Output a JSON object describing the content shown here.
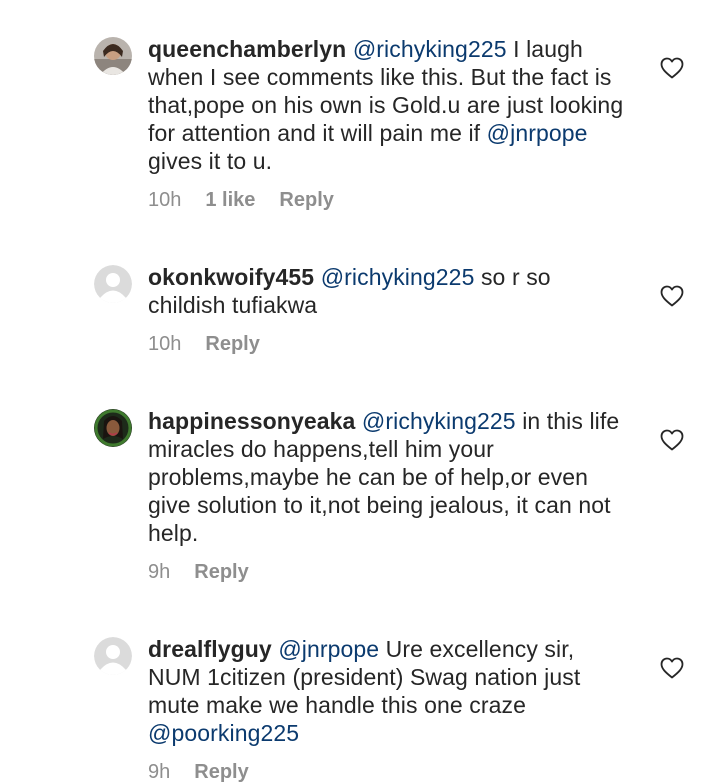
{
  "comments": [
    {
      "username": "queenchamberlyn",
      "mention": "@richyking225",
      "text_parts": [
        " I laugh when I see comments like this. But the fact is that,pope on his own is Gold.u are just looking for attention and it will pain me if ",
        "@jnrpope",
        " gives it to u."
      ],
      "time": "10h",
      "likes": "1 like",
      "reply": "Reply",
      "avatar": "photo"
    },
    {
      "username": "okonkwoify455",
      "mention": "@richyking225",
      "text_parts": [
        "  so r so childish tufiakwa"
      ],
      "time": "10h",
      "reply": "Reply",
      "avatar": "default"
    },
    {
      "username": "happinessonyeaka",
      "mention": "@richyking225",
      "text_parts": [
        " in this life miracles do happens,tell him your problems,maybe he can be of help,or even give solution to it,not being jealous, it can not help."
      ],
      "time": "9h",
      "reply": "Reply",
      "avatar": "photo-dark"
    },
    {
      "username": "drealflyguy",
      "mention": "@jnrpope",
      "text_parts": [
        " Ure excellency sir, NUM 1citizen (president) Swag nation just mute make  we handle this one craze ",
        "@poorking225"
      ],
      "time": "9h",
      "reply": "Reply",
      "avatar": "default"
    }
  ],
  "colors": {
    "text": "#262626",
    "mention": "#0b3a6e",
    "meta": "#8e8e8e",
    "icon": "#262626"
  },
  "icons": {
    "like": "heart-outline-icon"
  }
}
